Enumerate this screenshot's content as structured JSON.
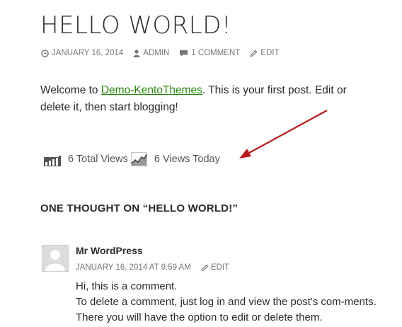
{
  "post": {
    "title": "HELLO WORLD!",
    "meta": {
      "date": "JANUARY 16, 2014",
      "author": "ADMIN",
      "comments": "1 COMMENT",
      "edit": "EDIT"
    },
    "content": {
      "before_link": "Welcome to ",
      "link_text": "Demo-KentoThemes",
      "after_link": ". This is your first post. Edit or delete it, then start blogging!"
    },
    "views": {
      "total": "6 Total Views",
      "today": "6 Views Today"
    }
  },
  "comments_section": {
    "heading": "ONE THOUGHT ON “HELLO WORLD!”",
    "comment": {
      "author": "Mr WordPress",
      "datetime": "JANUARY 16, 2014 AT 9:59 AM",
      "edit": "EDIT",
      "lines": [
        "Hi, this is a comment.",
        "To delete a comment, just log in and view the post's com-ments. There you will have the option to edit or delete them."
      ]
    }
  },
  "colors": {
    "link": "#24890d",
    "arrow": "#b71c1c",
    "meta": "#767676"
  },
  "icons": [
    "clock-icon",
    "user-icon",
    "comment-icon",
    "pencil-icon",
    "bar-chart-icon",
    "trend-chart-icon",
    "arrow-annotation"
  ]
}
